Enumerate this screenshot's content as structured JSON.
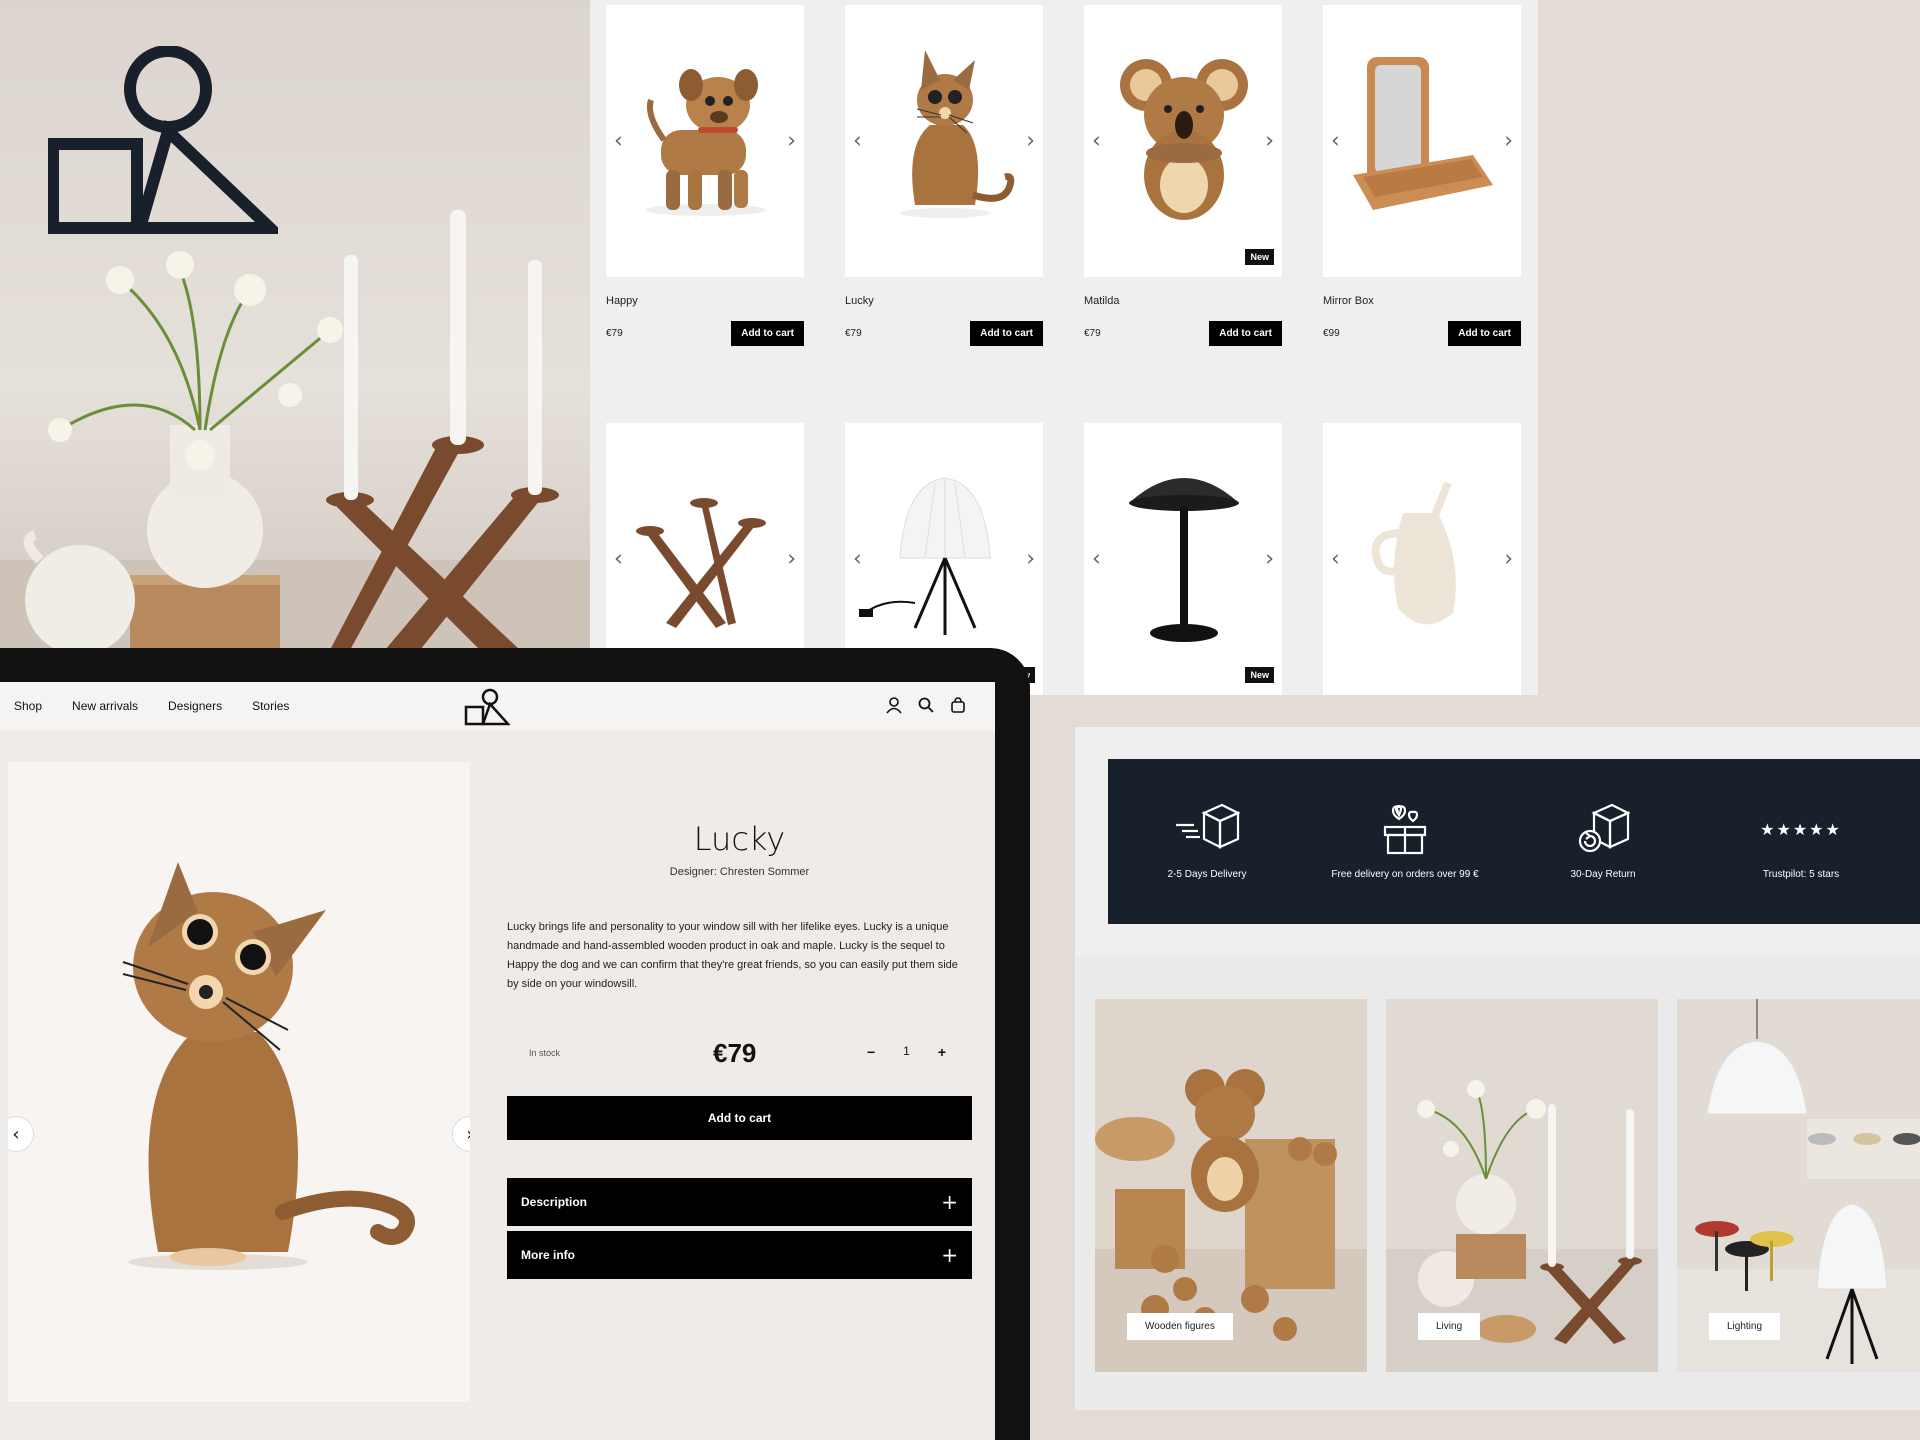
{
  "products": [
    {
      "name": "Happy",
      "price": "€79",
      "cta": "Add to cart",
      "badge": ""
    },
    {
      "name": "Lucky",
      "price": "€79",
      "cta": "Add to cart",
      "badge": ""
    },
    {
      "name": "Matilda",
      "price": "€79",
      "cta": "Add to cart",
      "badge": "New"
    },
    {
      "name": "Mirror Box",
      "price": "€99",
      "cta": "Add to cart",
      "badge": ""
    }
  ],
  "products_row2_badges": [
    "",
    "New",
    "New",
    ""
  ],
  "nav": {
    "links": [
      "Shop",
      "New arrivals",
      "Designers",
      "Stories"
    ]
  },
  "product_detail": {
    "title": "Lucky",
    "designer": "Designer: Chresten Sommer",
    "description": "Lucky brings life and personality to your window sill with her lifelike eyes. Lucky is a unique handmade and hand-assembled wooden product in oak and maple. Lucky is the sequel to Happy the dog and we can confirm that they're great friends, so you can easily put them side by side on your windowsill.",
    "stock": "In stock",
    "price": "€79",
    "qty": "1",
    "qty_minus": "−",
    "qty_plus": "+",
    "add_to_cart": "Add to cart",
    "accordions": [
      {
        "label": "Description",
        "icon": "+"
      },
      {
        "label": "More info",
        "icon": "+"
      }
    ]
  },
  "usps": [
    {
      "label": "2-5 Days Delivery",
      "icon": "delivery-box-icon"
    },
    {
      "label": "Free delivery on orders over 99 €",
      "icon": "gift-box-hearts-icon"
    },
    {
      "label": "30-Day Return",
      "icon": "return-box-icon"
    },
    {
      "label": "Trustpilot: 5 stars",
      "stars": "★★★★★"
    }
  ],
  "categories": [
    {
      "label": "Wooden figures"
    },
    {
      "label": "Living"
    },
    {
      "label": "Lighting"
    }
  ],
  "colors": {
    "accent_dark": "#17202b",
    "button": "#000000",
    "background": "#e3dcd6",
    "wood": "#9a6a40"
  }
}
